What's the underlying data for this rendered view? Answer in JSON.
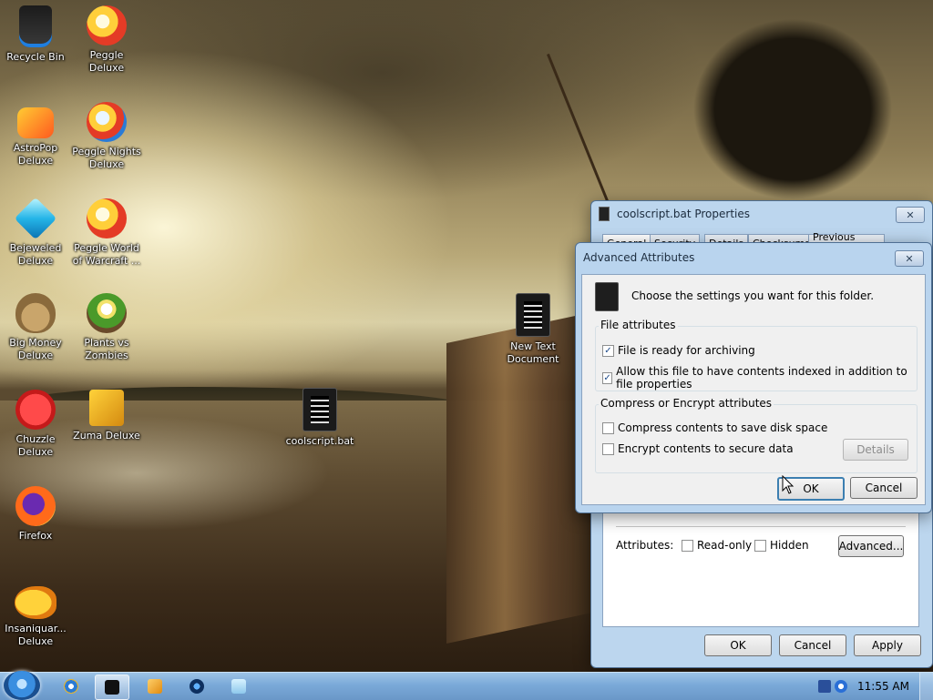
{
  "desktop_icons": [
    {
      "label": "Recycle Bin",
      "icon": "recycle-bin-icon"
    },
    {
      "label": "Peggle Deluxe",
      "icon": "peggle-icon"
    },
    {
      "label": "AstroPop Deluxe",
      "icon": "astropop-icon"
    },
    {
      "label": "Peggle Nights Deluxe",
      "icon": "peggle-nights-icon"
    },
    {
      "label": "Bejeweled Deluxe",
      "icon": "bejeweled-icon"
    },
    {
      "label": "Peggle World of Warcraft ...",
      "icon": "peggle-wow-icon"
    },
    {
      "label": "Big Money Deluxe",
      "icon": "big-money-icon"
    },
    {
      "label": "Plants vs Zombies",
      "icon": "plants-vs-zombies-icon"
    },
    {
      "label": "Chuzzle Deluxe",
      "icon": "chuzzle-icon"
    },
    {
      "label": "Zuma Deluxe",
      "icon": "zuma-icon"
    },
    {
      "label": "Firefox",
      "icon": "firefox-icon"
    },
    {
      "label": "Insaniquar... Deluxe",
      "icon": "insaniquarium-icon"
    },
    {
      "label": "coolscript.bat",
      "icon": "batch-file-icon"
    },
    {
      "label": "New Text Document",
      "icon": "text-document-icon"
    }
  ],
  "properties_window": {
    "title": "coolscript.bat Properties",
    "close_glyph": "✕",
    "tabs": [
      "General",
      "Security",
      "Details",
      "Checksums",
      "Previous Versions"
    ],
    "attributes_label": "Attributes:",
    "readonly_label": "Read-only",
    "readonly_checked": false,
    "hidden_label": "Hidden",
    "hidden_checked": false,
    "advanced_button": "Advanced...",
    "ok": "OK",
    "cancel": "Cancel",
    "apply": "Apply"
  },
  "advanced_dialog": {
    "title": "Advanced Attributes",
    "close_glyph": "✕",
    "intro": "Choose the settings you want for this folder.",
    "file_attributes_title": "File attributes",
    "archive_label": "File is ready for archiving",
    "archive_checked": true,
    "index_label": "Allow this file to have contents indexed in addition to file properties",
    "index_checked": true,
    "compress_group_title": "Compress or Encrypt attributes",
    "compress_label": "Compress contents to save disk space",
    "compress_checked": false,
    "encrypt_label": "Encrypt contents to secure data",
    "encrypt_checked": false,
    "details_button": "Details",
    "ok": "OK",
    "cancel": "Cancel"
  },
  "taskbar": {
    "clock": "11:55 AM",
    "items": [
      "internet-explorer-icon",
      "cmd-icon",
      "media-player-icon",
      "media-center-icon",
      "notepad-icon"
    ]
  },
  "colors": {
    "accent": "#3c7fb1",
    "taskbar": "#7aa9d8",
    "dialog_frame": "#bcd6ee"
  }
}
